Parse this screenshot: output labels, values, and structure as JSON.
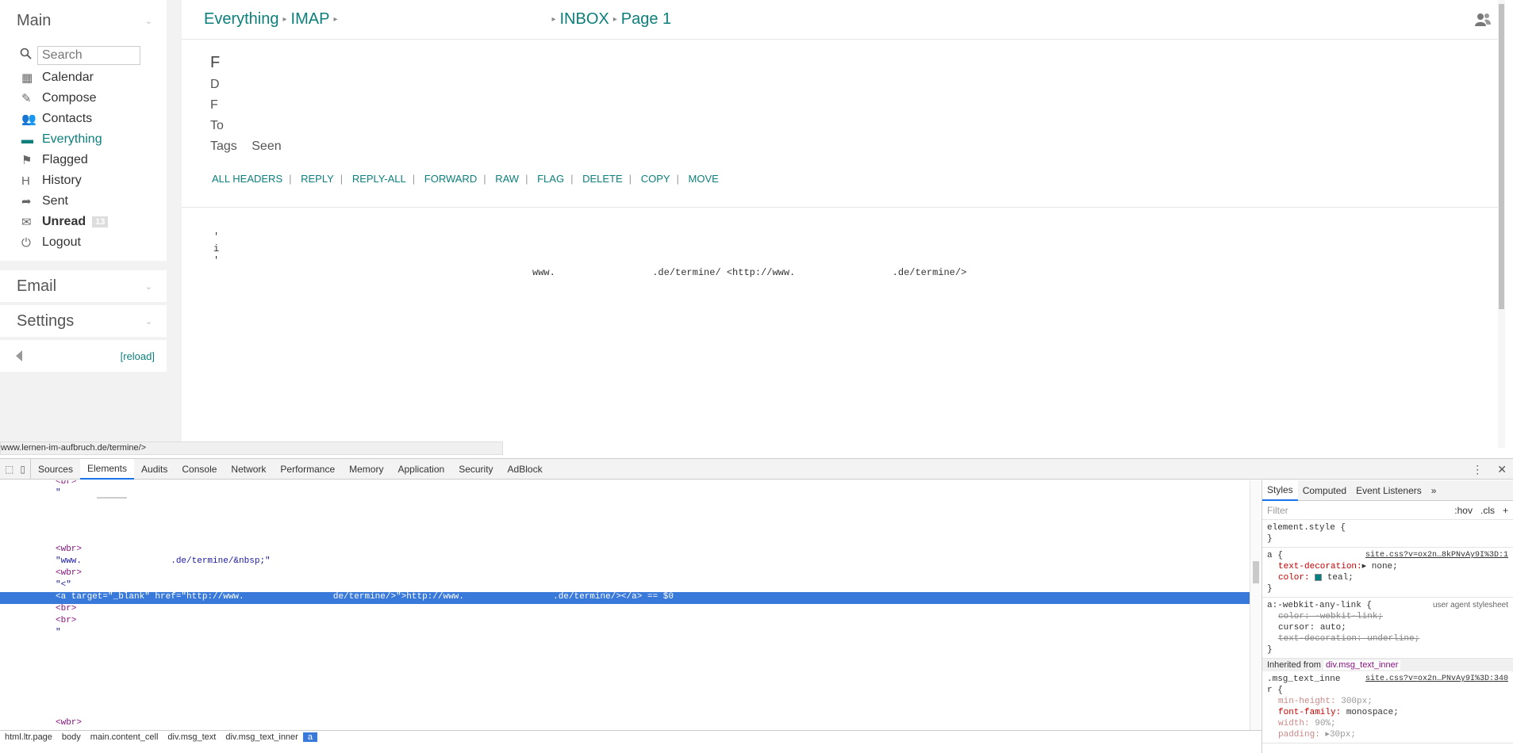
{
  "sidebar": {
    "main_title": "Main",
    "search_placeholder": "Search",
    "items": [
      {
        "label": "Calendar",
        "icon": "calendar-icon"
      },
      {
        "label": "Compose",
        "icon": "compose-icon"
      },
      {
        "label": "Contacts",
        "icon": "contacts-icon"
      },
      {
        "label": "Everything",
        "icon": "everything-icon"
      },
      {
        "label": "Flagged",
        "icon": "flag-icon"
      },
      {
        "label": "History",
        "icon": "history-icon"
      },
      {
        "label": "Sent",
        "icon": "sent-icon"
      },
      {
        "label": "Unread",
        "icon": "envelope-icon",
        "badge": "13"
      },
      {
        "label": "Logout",
        "icon": "power-icon"
      }
    ],
    "email_title": "Email",
    "settings_title": "Settings",
    "reload_label": "[reload]"
  },
  "breadcrumb": {
    "item1": "Everything",
    "item2": "IMAP",
    "item3": "INBOX",
    "item4": "Page 1"
  },
  "message": {
    "header_initials": [
      "F",
      "D",
      "F",
      "To"
    ],
    "tags_label": "Tags",
    "tags_value": "Seen",
    "actions": [
      "ALL HEADERS",
      "REPLY",
      "REPLY-ALL",
      "FORWARD",
      "RAW",
      "FLAG",
      "DELETE",
      "COPY",
      "MOVE"
    ],
    "body_fragments": [
      "'",
      "i",
      "'"
    ],
    "url_line": "www.                 .de/termine/ <http://www.                 .de/termine/>"
  },
  "status_url": "www.lernen-im-aufbruch.de/termine/>",
  "devtools": {
    "tabs": [
      "Sources",
      "Elements",
      "Audits",
      "Console",
      "Network",
      "Performance",
      "Memory",
      "Application",
      "Security",
      "AdBlock"
    ],
    "active_tab": "Elements",
    "lines": {
      "l1": "<br>",
      "l2": "\"",
      "l3": "<wbr>",
      "l4": "\"www.                 .de/termine/&nbsp;\"",
      "l5": "<wbr>",
      "l6": "\"<\"",
      "sel": "<a target=\"_blank\" href=\"http://www.                 de/termine/>\">http://www.                 .de/termine/></a> == $0",
      "l8": "<br>",
      "l9": "<br>",
      "l10": "\"",
      "l11": "<wbr>"
    },
    "styles_tabs": [
      "Styles",
      "Computed",
      "Event Listeners"
    ],
    "filter_placeholder": "Filter",
    "filter_hov": ":hov",
    "filter_cls": ".cls",
    "rule1": "element.style {",
    "rule2_sel": "a {",
    "rule2_src": "site.css?v=ox2n…8kPNvAy9I%3D:1",
    "rule2_p1_name": "text-decoration:",
    "rule2_p1_val": "none;",
    "rule2_p2_name": "color:",
    "rule2_p2_val": "teal;",
    "rule3_sel": "a:-webkit-any-link {",
    "rule3_src": "user agent stylesheet",
    "rule3_p1": "color: -webkit-link;",
    "rule3_p2_name": "cursor:",
    "rule3_p2_val": "auto;",
    "rule3_p3": "text-decoration: underline;",
    "inherited_label": "Inherited from",
    "inherited_el": "div.msg_text_inner",
    "rule4_sel": ".msg_text_inne r {",
    "rule4_src": "site.css?v=ox2n…PNvAy9I%3D:340",
    "rule4_p1_name": "min-height:",
    "rule4_p1_val": "300px;",
    "rule4_p2_name": "font-family:",
    "rule4_p2_val": "monospace;",
    "rule4_p3_name": "width:",
    "rule4_p3_val": "90%;",
    "rule4_p4_name": "padding:",
    "rule4_p4_val": "30px;",
    "crumbs": [
      "html.ltr.page",
      "body",
      "main.content_cell",
      "div.msg_text",
      "div.msg_text_inner",
      "a"
    ]
  },
  "colors": {
    "accent": "#0c7f7b",
    "selection": "#3879d9"
  }
}
